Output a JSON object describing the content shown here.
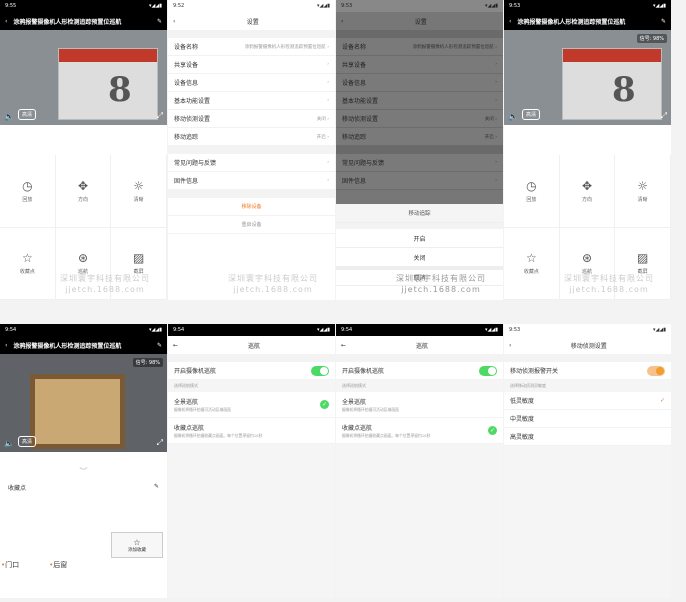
{
  "s1": {
    "time": "9:55",
    "title": "涂鸦报警摄像机人形检测追踪预置位巡航",
    "hd": "高清",
    "controls": [
      "回放",
      "方向",
      "清晰",
      "收藏点",
      "巡航",
      "截屏"
    ],
    "watermark": [
      "深圳寰宇科技有限公司",
      "jjetch.1688.com"
    ]
  },
  "s2": {
    "time": "9:52",
    "title": "设置",
    "rows": [
      {
        "label": "设备名称",
        "value": "涂鸦报警摄像机人形检测追踪预置位巡航"
      },
      {
        "label": "共享设备",
        "value": ""
      },
      {
        "label": "设备信息",
        "value": ""
      },
      {
        "label": "基本功能设置",
        "value": ""
      },
      {
        "label": "移动侦测设置",
        "value": "关闭"
      },
      {
        "label": "移动追踪",
        "value": "开启"
      }
    ],
    "rows2": [
      {
        "label": "常见问题与反馈"
      },
      {
        "label": "固件信息"
      }
    ],
    "remove": "移除设备",
    "restart": "重启设备",
    "watermark": [
      "深圳寰宇科技有限公司",
      "jjetch.1688.com"
    ]
  },
  "s3": {
    "time": "9:53",
    "title": "设置",
    "sheet_title": "移动追踪",
    "on": "开启",
    "off": "关闭",
    "cancel": "取消",
    "watermark": [
      "深圳寰宇科技有限公司",
      "jjetch.1688.com"
    ]
  },
  "s4": {
    "time": "9:53",
    "title": "涂鸦报警摄像机人形检测追踪预置位巡航",
    "hd": "高清",
    "signal": "信号: 98%",
    "controls": [
      "回放",
      "方向",
      "清晰",
      "收藏点",
      "巡航",
      "截屏"
    ],
    "watermark": [
      "深圳寰宇科技有限公司",
      "jjetch.1688.com"
    ]
  },
  "s5": {
    "time": "9:54",
    "title": "涂鸦报警摄像机人形检测追踪预置位巡航",
    "hd": "高清",
    "signal": "信号: 98%",
    "fav_label": "收藏点",
    "add_btn": "添加收藏",
    "pts": [
      "门口",
      "后窗"
    ]
  },
  "s6": {
    "time": "9:54",
    "title": "巡航",
    "toggle_label": "开启摄像机巡航",
    "mode_label": "选择巡航模式",
    "opt1": "全景巡航",
    "opt1_sub": "摄像机将循环拍摄可活动区域画面",
    "opt2": "收藏点巡航",
    "opt2_sub": "摄像机将循环拍摄收藏点画面。每个位置停留约10秒"
  },
  "s7": {
    "time": "9:54",
    "title": "巡航",
    "toggle_label": "开启摄像机巡航",
    "mode_label": "选择巡航模式",
    "opt1": "全景巡航",
    "opt1_sub": "摄像机将循环拍摄可活动区域画面",
    "opt2": "收藏点巡航",
    "opt2_sub": "摄像机将循环拍摄收藏点画面。每个位置停留约10秒"
  },
  "s8": {
    "time": "9:53",
    "title": "移动侦测设置",
    "toggle_label": "移动侦测报警开关",
    "sens_label": "选择移动侦测灵敏度",
    "levels": [
      "低灵敏度",
      "中灵敏度",
      "高灵敏度"
    ]
  },
  "colors": {
    "accent": "#f07c28",
    "green": "#4cd964"
  }
}
